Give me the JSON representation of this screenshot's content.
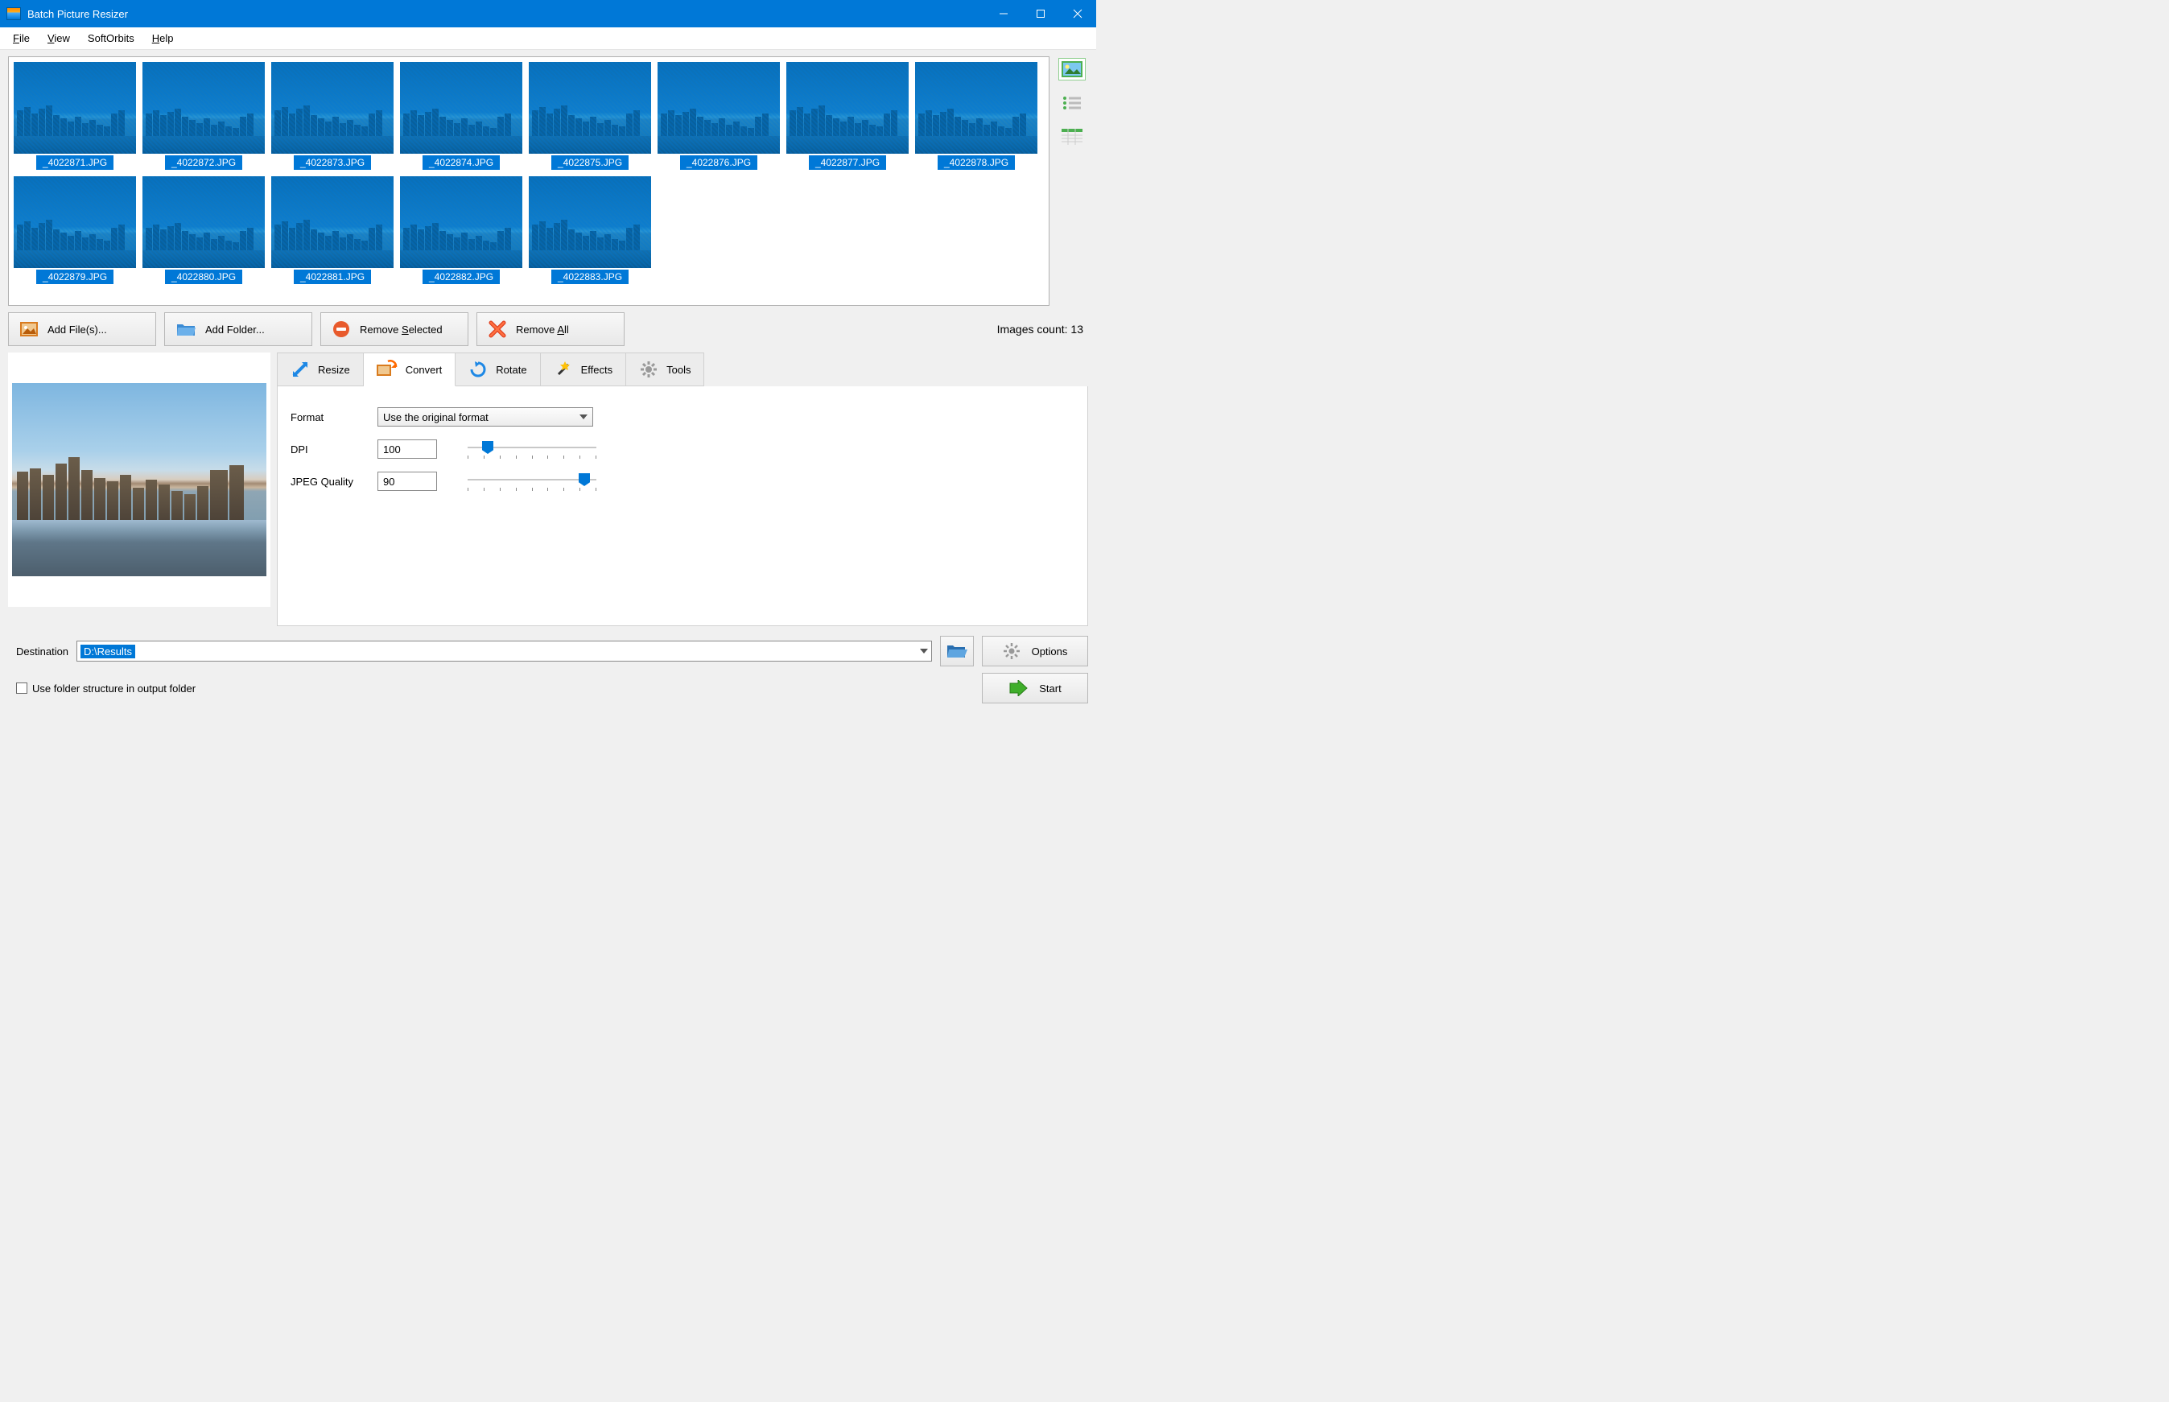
{
  "window": {
    "title": "Batch Picture Resizer"
  },
  "menu": {
    "file": "File",
    "view": "View",
    "softorbits": "SoftOrbits",
    "help": "Help"
  },
  "thumbnails": [
    {
      "label": "_4022871.JPG"
    },
    {
      "label": "_4022872.JPG"
    },
    {
      "label": "_4022873.JPG"
    },
    {
      "label": "_4022874.JPG"
    },
    {
      "label": "_4022875.JPG"
    },
    {
      "label": "_4022876.JPG"
    },
    {
      "label": "_4022877.JPG"
    },
    {
      "label": "_4022878.JPG"
    },
    {
      "label": "_4022879.JPG"
    },
    {
      "label": "_4022880.JPG"
    },
    {
      "label": "_4022881.JPG"
    },
    {
      "label": "_4022882.JPG"
    },
    {
      "label": "_4022883.JPG"
    }
  ],
  "toolbar": {
    "add_files": "Add File(s)...",
    "add_folder": "Add Folder...",
    "remove_selected_pre": "Remove ",
    "remove_selected_ul": "S",
    "remove_selected_post": "elected",
    "remove_all_pre": "Remove ",
    "remove_all_ul": "A",
    "remove_all_post": "ll"
  },
  "count_label": "Images count: 13",
  "tabs": {
    "resize": "Resize",
    "convert": "Convert",
    "rotate": "Rotate",
    "effects": "Effects",
    "tools": "Tools"
  },
  "convert": {
    "format_label": "Format",
    "format_value": "Use the original format",
    "dpi_label": "DPI",
    "dpi_value": "100",
    "jpeg_label": "JPEG Quality",
    "jpeg_value": "90"
  },
  "bottom": {
    "destination_label": "Destination",
    "destination_value": "D:\\Results",
    "use_folder_structure": "Use folder structure in output folder",
    "options": "Options",
    "start": "Start"
  }
}
